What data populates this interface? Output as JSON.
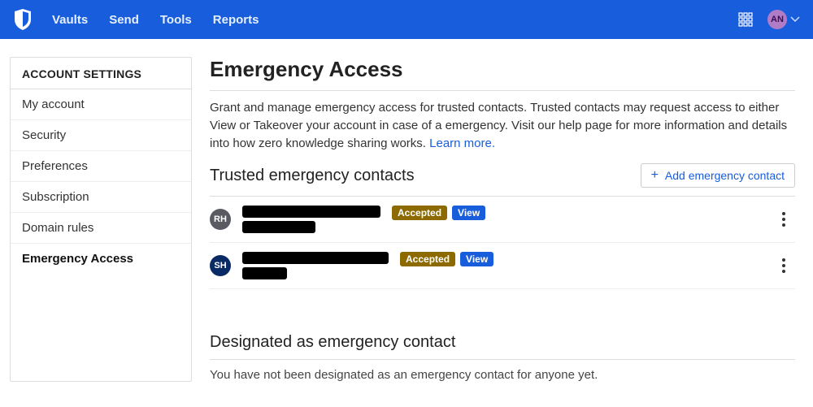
{
  "topnav": {
    "items": [
      "Vaults",
      "Send",
      "Tools",
      "Reports"
    ],
    "avatar_initials": "AN"
  },
  "sidebar": {
    "title": "ACCOUNT SETTINGS",
    "items": [
      {
        "label": "My account",
        "active": false
      },
      {
        "label": "Security",
        "active": false
      },
      {
        "label": "Preferences",
        "active": false
      },
      {
        "label": "Subscription",
        "active": false
      },
      {
        "label": "Domain rules",
        "active": false
      },
      {
        "label": "Emergency Access",
        "active": true
      }
    ]
  },
  "page": {
    "title": "Emergency Access",
    "description": "Grant and manage emergency access for trusted contacts. Trusted contacts may request access to either View or Takeover your account in case of a emergency. Visit our help page for more information and details into how zero knowledge sharing works. ",
    "learn_more": "Learn more."
  },
  "trusted": {
    "title": "Trusted emergency contacts",
    "add_button": "Add emergency contact",
    "contacts": [
      {
        "initials": "RH",
        "badge_color": "#5a5a63",
        "status": "Accepted",
        "permission": "View"
      },
      {
        "initials": "SH",
        "badge_color": "#0a2a66",
        "status": "Accepted",
        "permission": "View"
      }
    ]
  },
  "designated": {
    "title": "Designated as emergency contact",
    "empty": "You have not been designated as an emergency contact for anyone yet."
  }
}
